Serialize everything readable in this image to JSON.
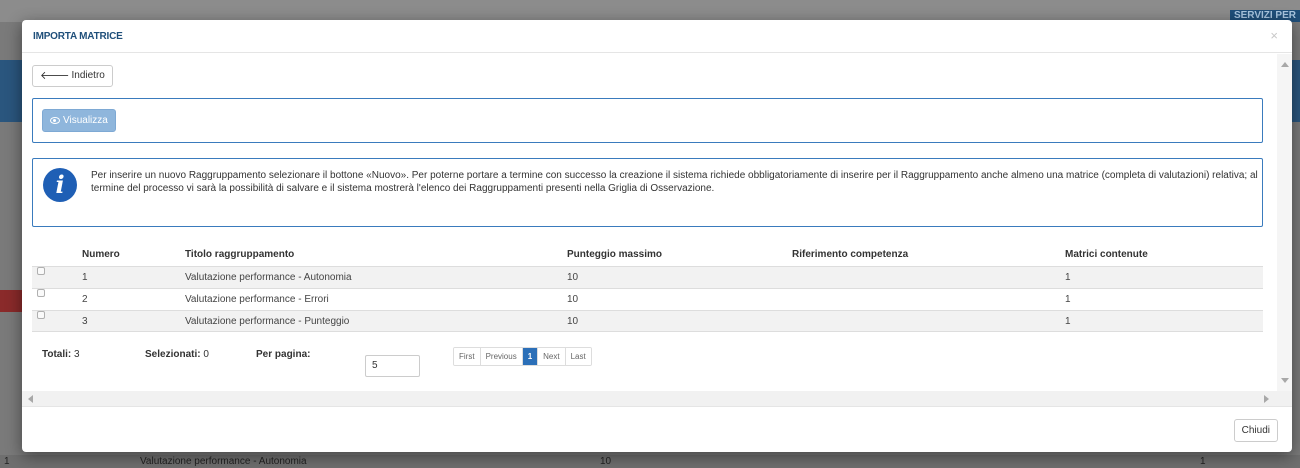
{
  "backdrop": {
    "top_right_label": "SERVIZI PER",
    "bottom_row": {
      "col1": "1",
      "title": "Valutazione performance - Autonomia",
      "score": "10",
      "count": "1"
    }
  },
  "modal": {
    "title": "IMPORTA MATRICE",
    "close_symbol": "×",
    "back_label": "Indietro",
    "view_label": "Visualizza",
    "info_text": "Per inserire un nuovo Raggruppamento selezionare il bottone «Nuovo». Per poterne portare a termine con successo la creazione il sistema richiede obbligatoriamente di inserire per il Raggruppamento anche almeno una matrice (completa di valutazioni) relativa; al termine del processo vi sarà la possibilità di salvare e il sistema mostrerà l'elenco dei Raggruppamenti presenti nella Griglia di Osservazione.",
    "columns": [
      "Numero",
      "Titolo raggruppamento",
      "Punteggio massimo",
      "Riferimento competenza",
      "Matrici contenute"
    ],
    "rows": [
      {
        "numero": "1",
        "titolo": "Valutazione performance - Autonomia",
        "punteggio": "10",
        "riferimento": "",
        "matrici": "1"
      },
      {
        "numero": "2",
        "titolo": "Valutazione performance - Errori",
        "punteggio": "10",
        "riferimento": "",
        "matrici": "1"
      },
      {
        "numero": "3",
        "titolo": "Valutazione performance - Punteggio",
        "punteggio": "10",
        "riferimento": "",
        "matrici": "1"
      }
    ],
    "footer": {
      "totali_label": "Totali:",
      "totali_value": "3",
      "selezionati_label": "Selezionati:",
      "selezionati_value": "0",
      "per_pagina_label": "Per pagina:",
      "per_pagina_value": "5"
    },
    "pager": {
      "first": "First",
      "previous": "Previous",
      "current": "1",
      "next": "Next",
      "last": "Last"
    },
    "close_button": "Chiudi"
  },
  "colors": {
    "accent": "#2b6fb8",
    "title": "#1f4f7a",
    "panel_border": "#3a7bbd",
    "info_icon": "#1f5fb5"
  },
  "icons": {
    "back": "arrow-left-icon",
    "view": "eye-icon",
    "info": "info-icon",
    "close": "close-icon"
  }
}
